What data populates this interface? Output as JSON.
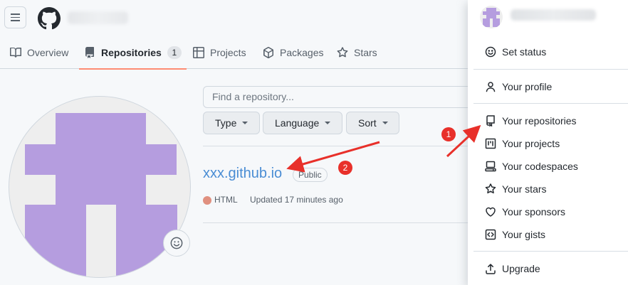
{
  "tabs": [
    {
      "label": "Overview",
      "icon": "book-open-icon"
    },
    {
      "label": "Repositories",
      "count": "1",
      "icon": "repo-icon"
    },
    {
      "label": "Projects",
      "icon": "table-icon"
    },
    {
      "label": "Packages",
      "icon": "package-icon"
    },
    {
      "label": "Stars",
      "icon": "star-icon"
    }
  ],
  "repos": {
    "search_placeholder": "Find a repository...",
    "filters": {
      "type": "Type",
      "language": "Language",
      "sort": "Sort"
    },
    "item": {
      "name": "xxx.github.io",
      "visibility": "Public",
      "language": "HTML",
      "language_color": "#e0907f",
      "updated": "Updated 17 minutes ago"
    }
  },
  "menu": {
    "set_status": "Set status",
    "profile": "Your profile",
    "repositories": "Your repositories",
    "projects": "Your projects",
    "codespaces": "Your codespaces",
    "stars": "Your stars",
    "sponsors": "Your sponsors",
    "gists": "Your gists",
    "upgrade": "Upgrade"
  },
  "annotations": {
    "marker1": "1",
    "marker2": "2",
    "color": "#e8302a"
  },
  "colors": {
    "avatar_purple": "#b59ddf",
    "link_blue": "#4a8dd4",
    "active_underline": "#fd8c73"
  }
}
